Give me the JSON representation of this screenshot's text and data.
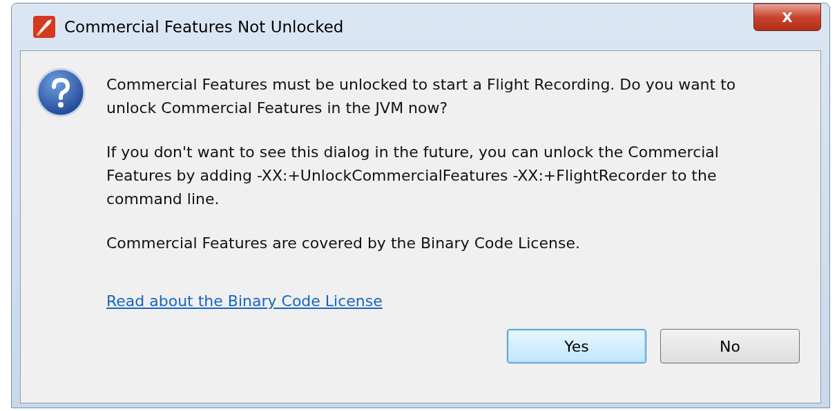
{
  "window": {
    "title": "Commercial Features Not Unlocked",
    "close": "X"
  },
  "message": {
    "paragraphs": [
      "Commercial Features must be unlocked to start a Flight Recording. Do you want to unlock Commercial Features in the JVM now?",
      "If you don't want to see this dialog in the future, you can unlock the Commercial Features by adding -XX:+UnlockCommercialFeatures -XX:+FlightRecorder to the command line.",
      "Commercial Features are covered by the Binary Code License."
    ]
  },
  "link": "Read about the Binary Code License",
  "buttons": [
    {
      "label": "Yes",
      "default": true
    },
    {
      "label": "No",
      "default": false
    }
  ]
}
